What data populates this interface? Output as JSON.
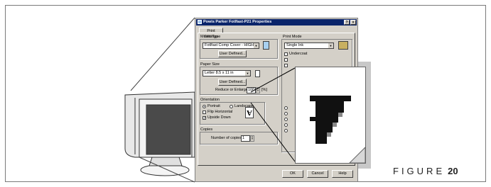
{
  "window": {
    "title": "Powis Parker Fotlfast-P21 Properties",
    "help_button": "?",
    "close_button": "×"
  },
  "tabs": [
    "Print Settings"
  ],
  "media_type": {
    "label": "Media Type",
    "value": "Fotlfast Comp Cover - HIGH",
    "user_defined": "User Defined..."
  },
  "paper_size": {
    "label": "Paper Size",
    "value": "Letter 8.5 x 11 in",
    "user_defined": "User Defined...",
    "reduce_label": "Reduce or Enlarge",
    "reduce_value": "100",
    "reduce_unit": "[%]"
  },
  "orientation": {
    "label": "Orientation",
    "portrait": "Portrait",
    "landscape": "Landscape",
    "portrait_selected": true,
    "flip_horizontal": "Flip Horizontal",
    "flip_checked": false,
    "upside_down": "Upside Down",
    "upside_checked": true
  },
  "copies": {
    "label": "Copies",
    "number_label": "Number of copies",
    "value": "1"
  },
  "print_mode": {
    "label": "Print Mode",
    "value": "Single Ink",
    "undercoat": "Undercoat"
  },
  "buttons": {
    "ok": "OK",
    "cancel": "Cancel",
    "help": "Help"
  },
  "figure": {
    "label": "FIGURE",
    "number": "20"
  }
}
